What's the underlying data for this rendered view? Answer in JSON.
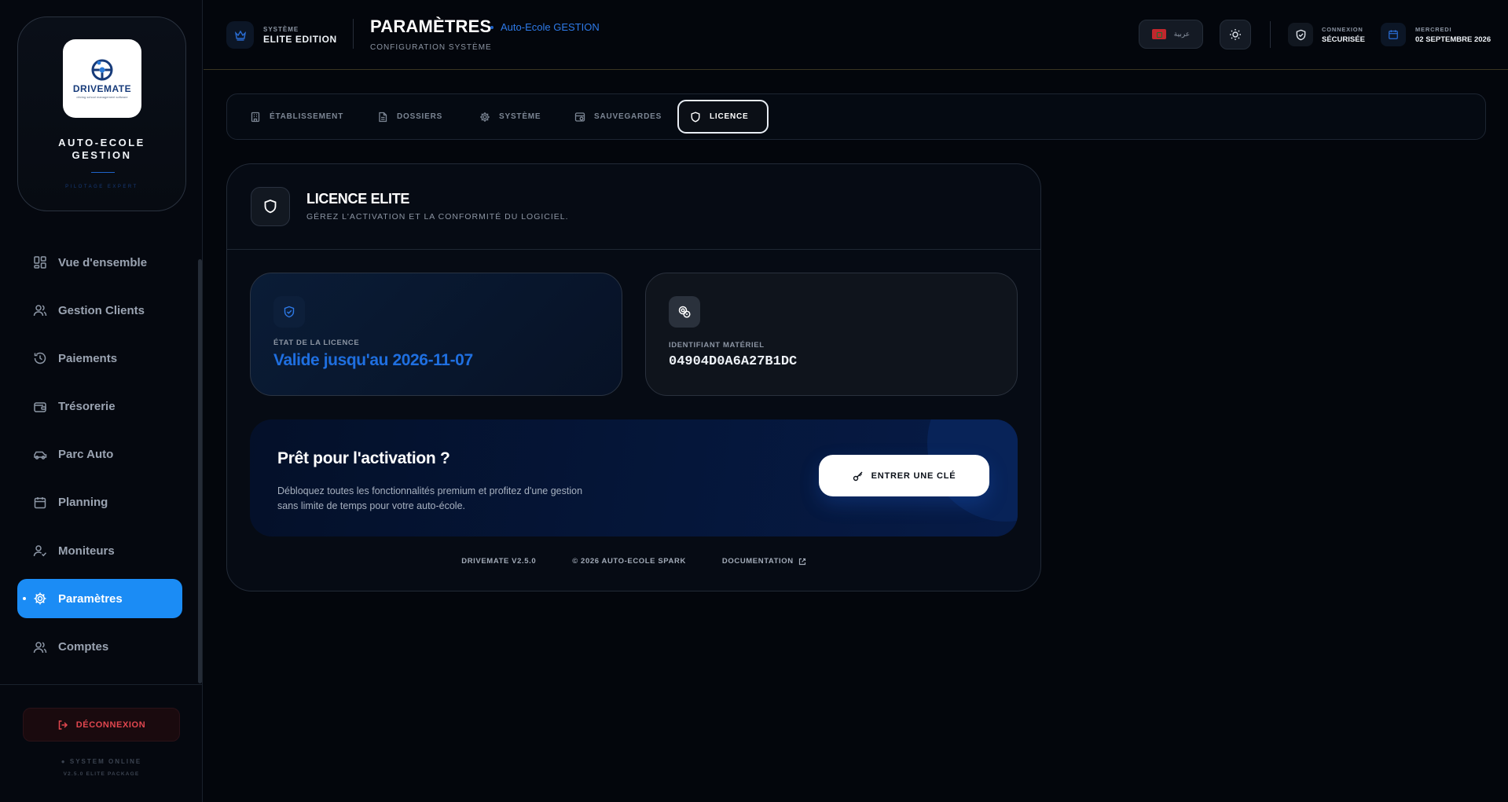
{
  "brand": {
    "logo_text": "DRIVEMATE",
    "logo_tagline": "driving school management software",
    "title_line1": "AUTO-ECOLE",
    "title_line2": "GESTION",
    "subtitle": "PILOTAGE EXPERT"
  },
  "sidebar": {
    "items": [
      {
        "label": "Vue d'ensemble",
        "icon": "grid-icon",
        "active": false
      },
      {
        "label": "Gestion Clients",
        "icon": "users-icon",
        "active": false
      },
      {
        "label": "Paiements",
        "icon": "history-icon",
        "active": false
      },
      {
        "label": "Trésorerie",
        "icon": "wallet-icon",
        "active": false
      },
      {
        "label": "Parc Auto",
        "icon": "car-icon",
        "active": false
      },
      {
        "label": "Planning",
        "icon": "calendar-icon",
        "active": false
      },
      {
        "label": "Moniteurs",
        "icon": "user-check-icon",
        "active": false
      },
      {
        "label": "Paramètres",
        "icon": "gear-icon",
        "active": true
      },
      {
        "label": "Comptes",
        "icon": "users-icon",
        "active": false
      }
    ],
    "logout_label": "DÉCONNEXION",
    "system_status": "● SYSTEM ONLINE",
    "version_package": "V2.5.0 ELITE PACKAGE"
  },
  "header": {
    "system_label": "SYSTÈME",
    "edition": "ELITE EDITION",
    "title": "PARAMÈTRES",
    "app_name": "Auto-Ecole GESTION",
    "subtitle": "CONFIGURATION SYSTÈME",
    "language_label": "عربية",
    "connection_label": "CONNEXION",
    "connection_value": "SÉCURISÉE",
    "day_label": "MERCREDI",
    "date_value": "02 SEPTEMBRE 2026"
  },
  "tabs": [
    {
      "label": "ÉTABLISSEMENT",
      "icon": "building-icon",
      "active": false
    },
    {
      "label": "DOSSIERS",
      "icon": "file-icon",
      "active": false
    },
    {
      "label": "SYSTÈME",
      "icon": "gear-icon",
      "active": false
    },
    {
      "label": "SAUVEGARDES",
      "icon": "backup-icon",
      "active": false
    },
    {
      "label": "LICENCE",
      "icon": "shield-icon",
      "active": true
    }
  ],
  "license": {
    "title": "LICENCE ELITE",
    "subtitle": "GÉREZ L'ACTIVATION ET LA CONFORMITÉ DU LOGICIEL.",
    "status_label": "ÉTAT DE LA LICENCE",
    "status_value": "Valide jusqu'au 2026-11-07",
    "hardware_label": "IDENTIFIANT MATÉRIEL",
    "hardware_id": "04904D0A6A27B1DC",
    "activation_title": "Prêt pour l'activation ?",
    "activation_desc": "Débloquez toutes les fonctionnalités premium et profitez d'une gestion sans limite de temps pour votre auto-école.",
    "activation_button": "ENTRER UNE CLÉ"
  },
  "footer": {
    "version": "DRIVEMATE V2.5.0",
    "copyright": "© 2026 AUTO-ECOLE SPARK",
    "documentation": "DOCUMENTATION"
  },
  "colors": {
    "accent": "#1b8cf5",
    "status_blue": "#1f6fe0",
    "danger": "#e2474f",
    "background": "#03060c"
  }
}
